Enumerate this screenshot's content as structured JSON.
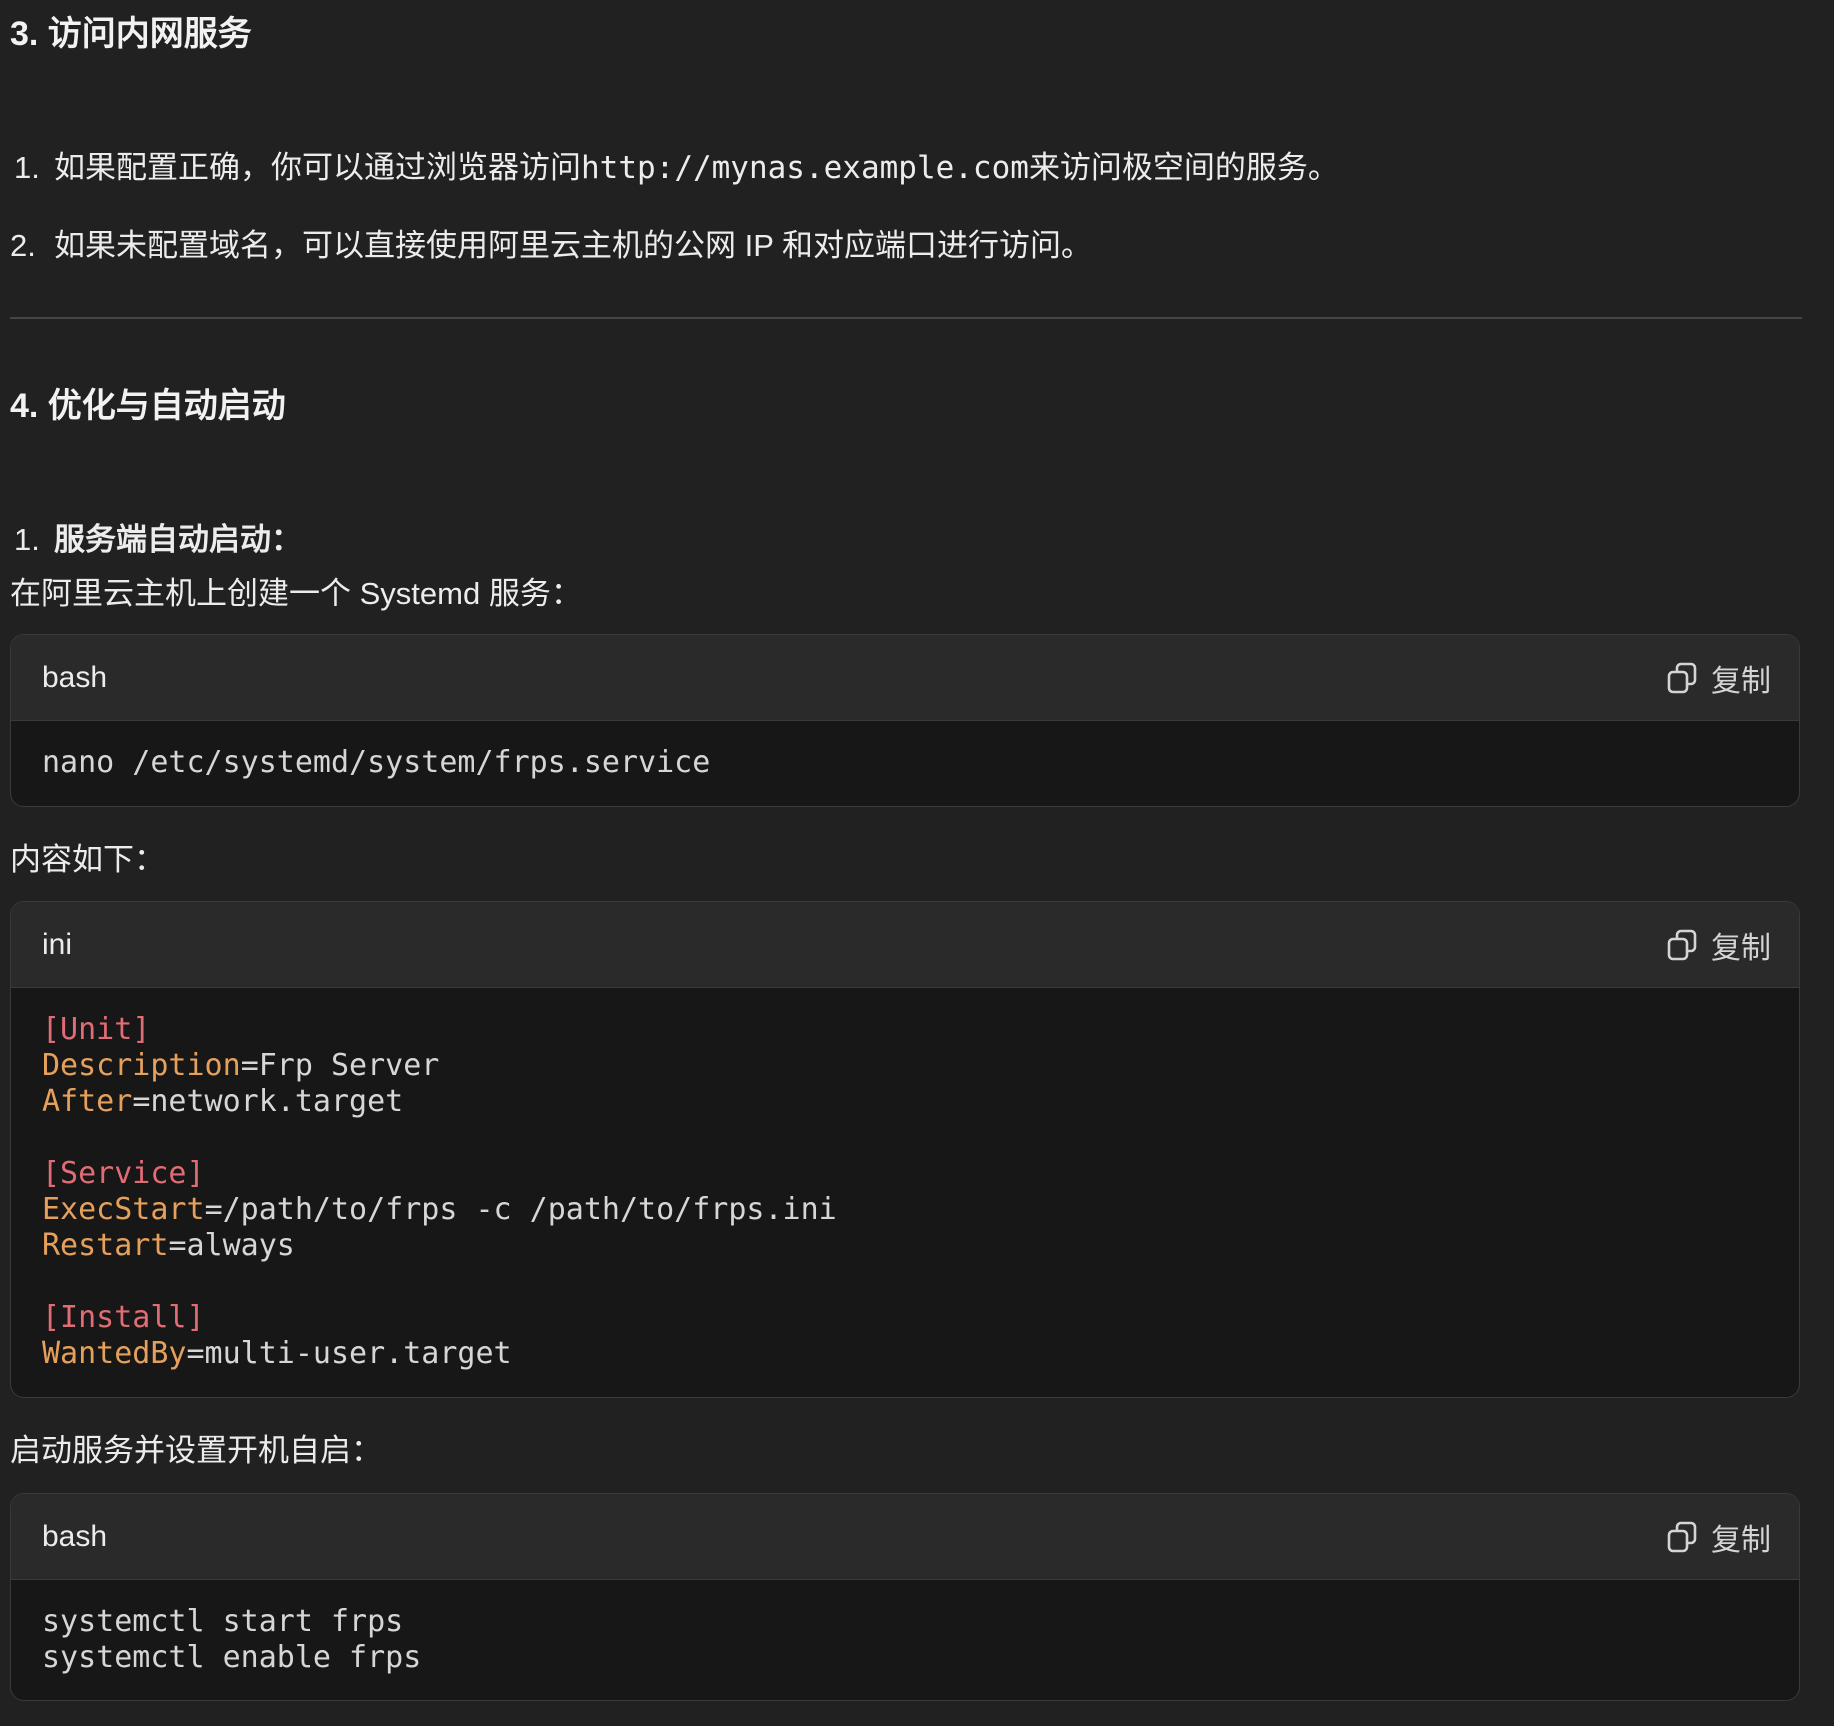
{
  "section3": {
    "title": "3. 访问内网服务",
    "items": [
      {
        "num": "1.",
        "before": "如果配置正确，你可以通过浏览器访问 ",
        "code": "http://mynas.example.com",
        "after": " 来访问极空间的服务。"
      },
      {
        "num": "2.",
        "text": "如果未配置域名，可以直接使用阿里云主机的公网 IP 和对应端口进行访问。"
      }
    ]
  },
  "section4": {
    "title": "4. 优化与自动启动",
    "item1": {
      "num": "1.",
      "label": "服务端自动启动："
    },
    "intro": "在阿里云主机上创建一个 Systemd 服务：",
    "content_label": "内容如下：",
    "start_label": "启动服务并设置开机自启："
  },
  "code_blocks": [
    {
      "lang": "bash",
      "copy_label": "复制",
      "lines": [
        [
          {
            "t": "nano /etc/systemd/system/frps.service",
            "c": "val"
          }
        ]
      ]
    },
    {
      "lang": "ini",
      "copy_label": "复制",
      "lines": [
        [
          {
            "t": "[Unit]",
            "c": "section"
          }
        ],
        [
          {
            "t": "Description",
            "c": "key"
          },
          {
            "t": "=Frp Server",
            "c": "val"
          }
        ],
        [
          {
            "t": "After",
            "c": "key"
          },
          {
            "t": "=network.target",
            "c": "val"
          }
        ],
        [],
        [
          {
            "t": "[Service]",
            "c": "section"
          }
        ],
        [
          {
            "t": "ExecStart",
            "c": "key"
          },
          {
            "t": "=/path/to/frps -c /path/to/frps.ini",
            "c": "val"
          }
        ],
        [
          {
            "t": "Restart",
            "c": "key"
          },
          {
            "t": "=always",
            "c": "val"
          }
        ],
        [],
        [
          {
            "t": "[Install]",
            "c": "section"
          }
        ],
        [
          {
            "t": "WantedBy",
            "c": "key"
          },
          {
            "t": "=multi-user.target",
            "c": "val"
          }
        ]
      ]
    },
    {
      "lang": "bash",
      "copy_label": "复制",
      "lines": [
        [
          {
            "t": "systemctl start frps",
            "c": "val"
          }
        ],
        [
          {
            "t": "systemctl enable frps",
            "c": "val"
          }
        ]
      ]
    }
  ],
  "colors": {
    "background": "#212121",
    "code_header": "#2a2a2a",
    "code_body": "#171717",
    "ini_section": "#e06c75",
    "ini_key": "#e5a05c",
    "text": "#ececec"
  },
  "icons": {
    "copy": "copy-icon"
  }
}
